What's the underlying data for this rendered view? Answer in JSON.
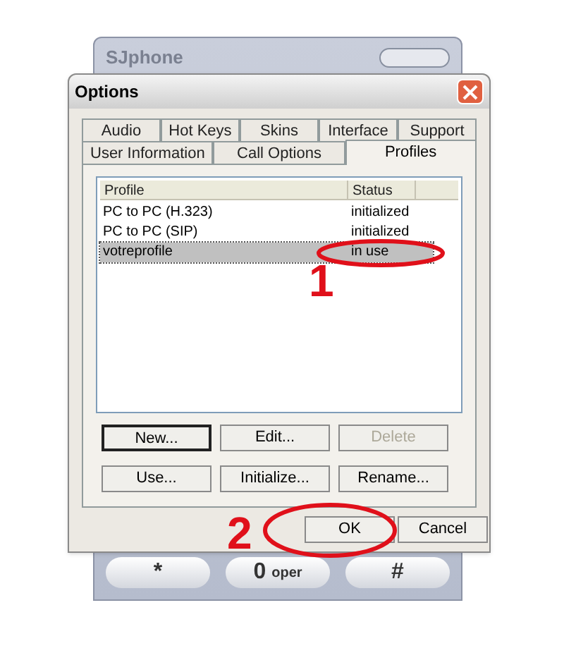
{
  "background_window": {
    "title": "SJphone",
    "keypad": [
      {
        "label": "*"
      },
      {
        "label": "0",
        "sublabel": "oper"
      },
      {
        "label": "#"
      }
    ]
  },
  "dialog": {
    "title": "Options",
    "tab_rows": [
      [
        {
          "label": "Audio",
          "selected": false
        },
        {
          "label": "Hot Keys",
          "selected": false
        },
        {
          "label": "Skins",
          "selected": false
        },
        {
          "label": "Interface",
          "selected": false
        },
        {
          "label": "Support",
          "selected": false
        }
      ],
      [
        {
          "label": "User Information",
          "selected": false
        },
        {
          "label": "Call Options",
          "selected": false
        },
        {
          "label": "Profiles",
          "selected": true
        }
      ]
    ],
    "table": {
      "columns": [
        "Profile",
        "Status"
      ],
      "rows": [
        {
          "profile": "PC to PC (H.323)",
          "status": "initialized",
          "selected": false
        },
        {
          "profile": "PC to PC (SIP)",
          "status": "initialized",
          "selected": false
        },
        {
          "profile": "votreprofile",
          "status": "in use",
          "selected": true
        }
      ]
    },
    "button_rows": [
      [
        {
          "label": "New...",
          "disabled": false,
          "default": true
        },
        {
          "label": "Edit...",
          "disabled": false,
          "default": false
        },
        {
          "label": "Delete",
          "disabled": true,
          "default": false
        }
      ],
      [
        {
          "label": "Use...",
          "disabled": false,
          "default": false
        },
        {
          "label": "Initialize...",
          "disabled": false,
          "default": false
        },
        {
          "label": "Rename...",
          "disabled": false,
          "default": false
        }
      ]
    ],
    "footer_buttons": [
      "OK",
      "Cancel"
    ]
  },
  "annotations": [
    {
      "label": "1"
    },
    {
      "label": "2"
    }
  ]
}
